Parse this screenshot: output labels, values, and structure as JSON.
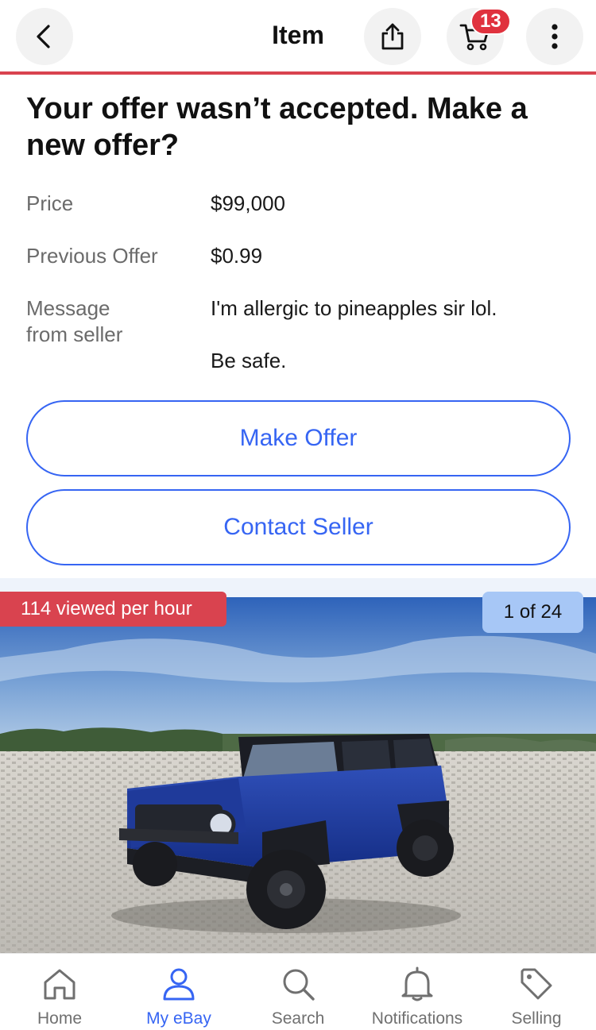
{
  "header": {
    "title": "Item",
    "cart_count": "13"
  },
  "offer": {
    "title": "Your offer wasn’t accepted. Make a new offer?",
    "rows": [
      {
        "label": "Price",
        "value": "$99,000"
      },
      {
        "label": "Previous Offer",
        "value": "$0.99"
      },
      {
        "label_line1": "Message",
        "label_line2": "from seller",
        "value_line1": "I'm allergic to pineapples sir lol.",
        "value_line2": "Be safe."
      }
    ],
    "make_offer_label": "Make Offer",
    "contact_seller_label": "Contact Seller"
  },
  "photo": {
    "viewed_badge": "114 viewed per hour",
    "counter": "1 of 24"
  },
  "bottom_nav": {
    "items": [
      {
        "label": "Home",
        "icon": "home-icon"
      },
      {
        "label": "My eBay",
        "icon": "person-icon"
      },
      {
        "label": "Search",
        "icon": "search-icon"
      },
      {
        "label": "Notifications",
        "icon": "bell-icon"
      },
      {
        "label": "Selling",
        "icon": "tag-icon"
      }
    ]
  },
  "colors": {
    "accent": "#3665f3",
    "header_line": "#d9434f",
    "badge_red": "#e0323e",
    "counter_bg": "#a7c7f6"
  }
}
